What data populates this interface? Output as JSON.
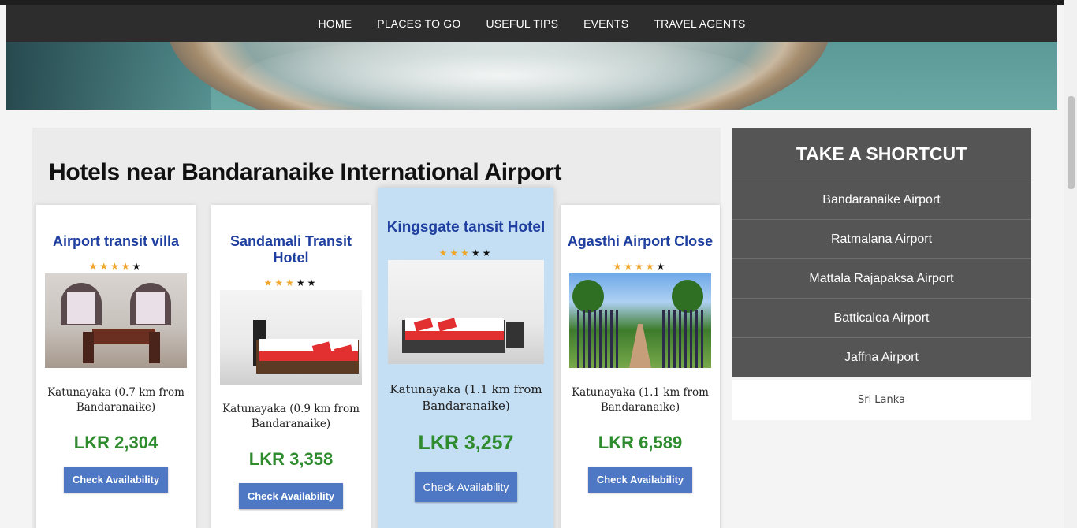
{
  "nav": {
    "items": [
      {
        "label": "HOME"
      },
      {
        "label": "PLACES TO GO"
      },
      {
        "label": "USEFUL TIPS"
      },
      {
        "label": "EVENTS"
      },
      {
        "label": "TRAVEL AGENTS"
      }
    ]
  },
  "main": {
    "heading": "Hotels near Bandaranaike International Airport",
    "hotels": [
      {
        "name": "Airport transit villa",
        "stars": 4,
        "location": "Katunayaka (0.7 km from Bandaranaike)",
        "price": "LKR 2,304",
        "button": "Check Availability"
      },
      {
        "name": "Sandamali Transit Hotel",
        "stars": 3,
        "location": "Katunayaka (0.9 km from Bandaranaike)",
        "price": "LKR 3,358",
        "button": "Check Availability"
      },
      {
        "name": "Kingsgate tansit Hotel",
        "stars": 3,
        "location": "Katunayaka (1.1 km from Bandaranaike)",
        "price": "LKR 3,257",
        "button": "Check Availability"
      },
      {
        "name": "Agasthi Airport Close",
        "stars": 4,
        "location": "Katunayaka (1.1 km from Bandaranaike)",
        "price": "LKR 6,589",
        "button": "Check Availability"
      }
    ]
  },
  "sidebar": {
    "title": "TAKE A SHORTCUT",
    "items": [
      {
        "label": "Bandaranaike Airport"
      },
      {
        "label": "Ratmalana Airport"
      },
      {
        "label": "Mattala Rajapaksa Airport"
      },
      {
        "label": "Batticaloa Airport"
      },
      {
        "label": "Jaffna Airport"
      }
    ],
    "footer": "Sri Lanka"
  },
  "colors": {
    "nav_bg": "#2d2d2d",
    "title_blue": "#1f3fa0",
    "price_green": "#2e8b2e",
    "button_blue": "#4e78c4",
    "featured_bg": "#c4dff3",
    "sidebar_bg": "#555555",
    "star_on": "#f0a52a"
  }
}
